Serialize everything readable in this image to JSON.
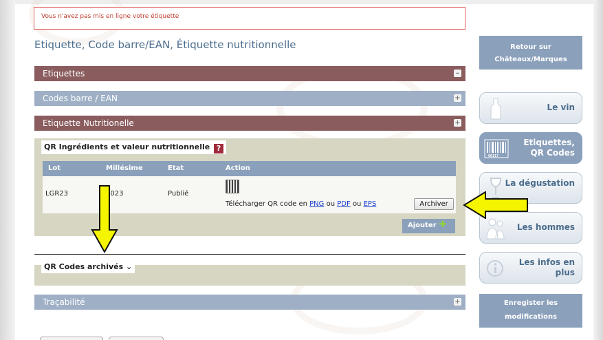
{
  "alert": {
    "message": "Vous n'avez pas mis en ligne votre étiquette"
  },
  "page_title": "Etiquette, Code barre/EAN, Étiquette nutritionnelle",
  "sections": {
    "etiquettes": "Etiquettes",
    "codes_barre": "Codes barre / EAN",
    "etiquette_nutri": "Etiquette Nutritionelle",
    "tracabilite": "Traçabilité"
  },
  "qr_section": {
    "title": "QR Ingrédients et valeur nutritionnelle",
    "help_icon": "help-question-icon",
    "columns": [
      "Lot",
      "Millésime",
      "Etat",
      "Action"
    ],
    "rows": [
      {
        "lot": "LGR23",
        "millesime": "2023",
        "etat": "Publié"
      }
    ],
    "download_prefix": "Télécharger QR code en",
    "download_png": "PNG",
    "download_or1": "ou",
    "download_pdf": "PDF",
    "download_or2": "ou",
    "download_eps": "EPS",
    "archive_button": "Archiver",
    "add_button": "Ajouter"
  },
  "archive_section": {
    "title": "QR Codes archivés",
    "chevron": "chevron-down-icon"
  },
  "right_nav": {
    "retour_line1": "Retour sur",
    "retour_line2": "Châteaux/Marques",
    "tab_vin": "Le vin",
    "tab_etiquettes_line1": "Etiquettes,",
    "tab_etiquettes_line2": "QR Codes",
    "tab_degustation": "La dégustation",
    "tab_hommes": "Les hommes",
    "tab_infos_line1": "Les infos en",
    "tab_infos_line2": "plus",
    "enregistrer_line1": "Enregister les",
    "enregistrer_line2": "modifications"
  },
  "colors": {
    "brown_bar": "#8a5c5e",
    "blue_bar": "#9fb0c6",
    "nav_blue": "#8aa0bb",
    "panel_beige": "#d7d6c2",
    "alert_red": "#e25a5a",
    "arrow_yellow": "#f5f500"
  }
}
